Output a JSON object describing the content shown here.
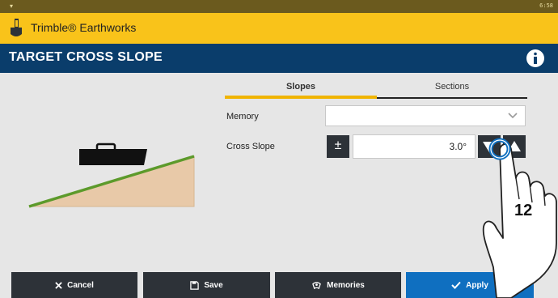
{
  "status": {
    "left": "8",
    "time": "6:58"
  },
  "app": {
    "title": "Trimble® Earthworks"
  },
  "page": {
    "title": "TARGET CROSS SLOPE"
  },
  "tabs": {
    "slopes": "Slopes",
    "sections": "Sections"
  },
  "form": {
    "memory_label": "Memory",
    "memory_value": "",
    "cross_slope_label": "Cross Slope",
    "cross_slope_value": "3.0°",
    "plus_minus": "±"
  },
  "buttons": {
    "cancel": "Cancel",
    "save": "Save",
    "memories": "Memories",
    "apply": "Apply"
  },
  "overlay": {
    "step_number": "12"
  },
  "colors": {
    "accent": "#f9c31a",
    "title_bar": "#0a3d6b",
    "apply": "#0f6fc0",
    "slope_line": "#5c9a2b",
    "fill": "#e8c9a8"
  },
  "icons": [
    "shovel-logo-icon",
    "machine-icon",
    "bell-icon",
    "worker-icon",
    "more-icon",
    "info-icon",
    "chevron-down-icon",
    "triangle-down-icon",
    "triangle-up-icon",
    "close-icon",
    "save-icon",
    "memories-icon",
    "check-icon"
  ]
}
